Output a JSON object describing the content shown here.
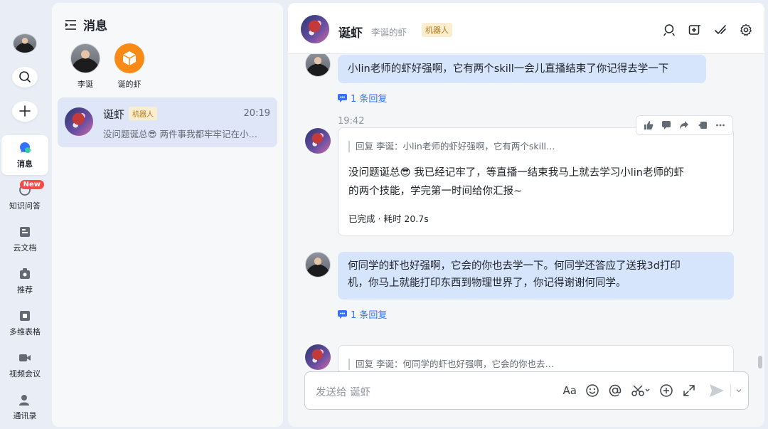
{
  "nav": {
    "items": [
      {
        "label": "消息",
        "icon": "chat-bubble-icon",
        "active": true
      },
      {
        "label": "知识问答",
        "icon": "knowledge-icon",
        "badge": "New"
      },
      {
        "label": "云文档",
        "icon": "cloud-doc-icon"
      },
      {
        "label": "推荐",
        "icon": "recommend-icon"
      },
      {
        "label": "多维表格",
        "icon": "table-icon"
      },
      {
        "label": "视频会议",
        "icon": "video-icon"
      },
      {
        "label": "通讯录",
        "icon": "contacts-icon"
      }
    ]
  },
  "list": {
    "title": "消息",
    "pinned": [
      {
        "name": "李诞"
      },
      {
        "name": "诞的虾"
      }
    ],
    "conversation": {
      "name": "诞虾",
      "tag": "机器人",
      "time": "20:19",
      "preview": "没问题诞总😎 两件事我都牢牢记在小…"
    }
  },
  "chat": {
    "title": "诞虾",
    "subtitle": "李诞的虾",
    "tag": "机器人",
    "messages": {
      "m1": {
        "text": "小lin老师的虾好强啊，它有两个skill一会儿直播结束了你记得去学一下",
        "reply_count": "1 条回复"
      },
      "time": "19:42",
      "m2": {
        "quote": "回复 李诞：小lin老师的虾好强啊，它有两个skill…",
        "line1": "没问题诞总😎 我已经记牢了，等直播一结束我马上就去学习小lin老师的虾",
        "line2": "的两个技能，学完第一时间给你汇报~",
        "status": "已完成 · 耗时 20.7s"
      },
      "m3": {
        "line1": "何同学的虾也好强啊，它会的你也去学一下。何同学还答应了送我3d打印",
        "line2": "机，你马上就能打印东西到物理世界了，你记得谢谢何同学。",
        "reply_count": "1 条回复"
      },
      "m4": {
        "quote": "回复 李诞：何同学的虾也好强啊，它会的你也去…"
      }
    },
    "input": {
      "placeholder": "发送给 诞虾",
      "format_label": "Aa"
    }
  }
}
